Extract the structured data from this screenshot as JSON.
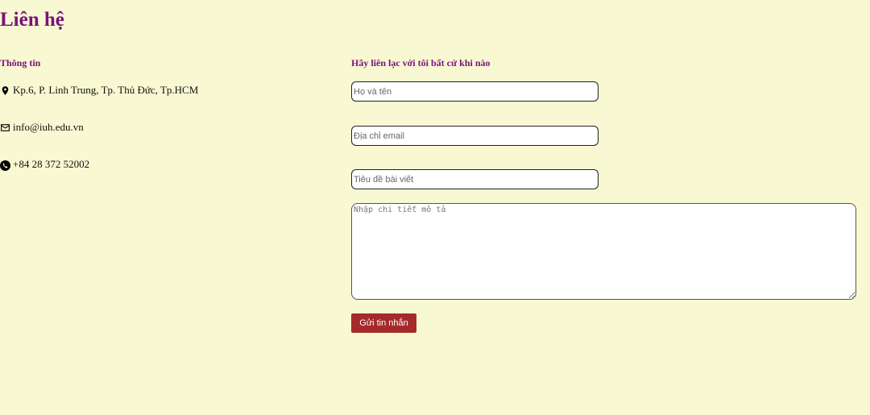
{
  "page": {
    "title": "Liên hệ"
  },
  "info": {
    "heading": "Thông tin",
    "address": "Kp.6, P. Linh Trung, Tp. Thủ Đức, Tp.HCM",
    "email": "info@iuh.edu.vn",
    "phone": "+84 28 372 52002",
    "icons": {
      "address": "location-pin-icon",
      "email": "envelope-icon",
      "phone": "phone-icon"
    }
  },
  "form": {
    "heading": "Hãy liên lạc với tôi bất cứ khi nào",
    "name_placeholder": "Họ và tên",
    "name_value": "",
    "email_placeholder": "Địa chỉ email",
    "email_value": "",
    "subject_placeholder": "Tiêu đề bài viết",
    "subject_value": "",
    "message_placeholder": "Nhập chi tiết mô tả",
    "message_value": "",
    "submit_label": "Gửi tin nhắn"
  },
  "colors": {
    "background": "#f8f8d2",
    "heading": "#7a127a",
    "button": "#a52a2a"
  }
}
